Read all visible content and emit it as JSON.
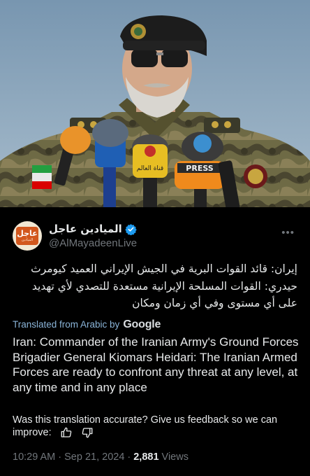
{
  "tweet": {
    "display_name": "الميادين عاجل",
    "handle": "@AlMayadeenLive",
    "avatar_text_big": "عاجل",
    "avatar_text_small": "الميادين",
    "body_arabic": "إيران: قائد القوات البرية في الجيش الإيراني العميد كيومرث حيدري: القوات المسلحة الإيرانية مستعدة للتصدي لأي تهديد على أي مستوى وفي أي زمان ومكان",
    "translated_label": "Translated from Arabic by",
    "translator_name": "Google",
    "body_english": "Iran: Commander of the Iranian Army's Ground Forces Brigadier General Kiomars Heidari: The Iranian Armed Forces are ready to confront any threat at any level, at any time and in any place",
    "feedback_text": "Was this translation accurate? Give us feedback so we can improve:",
    "time": "10:29 AM",
    "separator": "·",
    "date": "Sep 21, 2024",
    "views_count": "2,881",
    "views_label": "Views"
  },
  "photo": {
    "mic_labels": [
      "قناة العالم",
      "PRESS"
    ]
  },
  "colors": {
    "background": "#000000",
    "verified": "#1d9bf0",
    "secondary_text": "#71767b",
    "translated_link": "#8ab4d8"
  }
}
